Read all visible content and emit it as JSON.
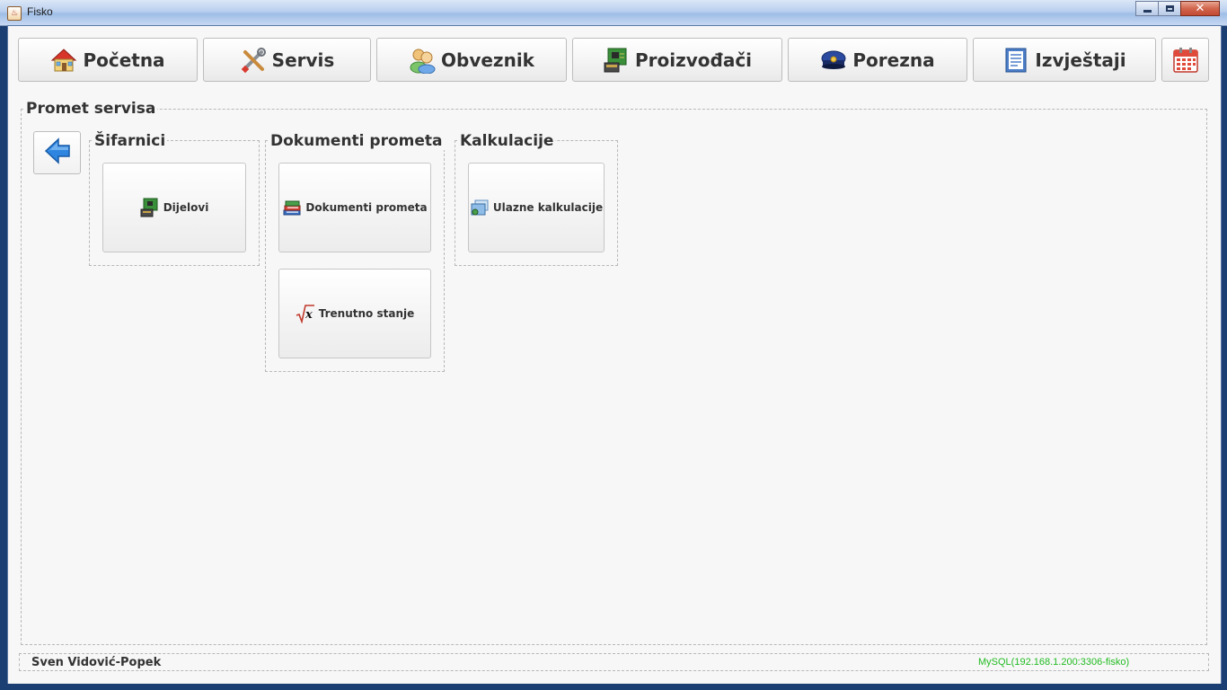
{
  "window": {
    "title": "Fisko",
    "controls": [
      "minimize-icon",
      "maximize-icon",
      "close-icon"
    ]
  },
  "toolbar": {
    "items": [
      {
        "label": "Početna",
        "icon": "home-icon"
      },
      {
        "label": "Servis",
        "icon": "tools-icon"
      },
      {
        "label": "Obveznik",
        "icon": "users-icon"
      },
      {
        "label": "Proizvođači",
        "icon": "circuit-board-icon"
      },
      {
        "label": "Porezna",
        "icon": "police-cap-icon"
      },
      {
        "label": "Izvještaji",
        "icon": "report-icon"
      },
      {
        "label": "",
        "icon": "calendar-icon"
      }
    ]
  },
  "main": {
    "title": "Promet servisa",
    "back_icon": "arrow-left-icon",
    "groups": [
      {
        "title": "Šifarnici",
        "tiles": [
          {
            "label": "Dijelovi",
            "icon": "parts-icon"
          }
        ]
      },
      {
        "title": "Dokumenti prometa",
        "tiles": [
          {
            "label": "Dokumenti prometa",
            "icon": "books-icon"
          },
          {
            "label": "Trenutno stanje",
            "icon": "sqrt-x-icon"
          }
        ]
      },
      {
        "title": "Kalkulacije",
        "tiles": [
          {
            "label": "Ulazne kalkulacije",
            "icon": "folders-icon"
          }
        ]
      }
    ]
  },
  "status": {
    "user": "Sven Vidović-Popek",
    "db": "MySQL(192.168.1.200:3306-fisko)",
    "db_color": "#22bb22"
  }
}
